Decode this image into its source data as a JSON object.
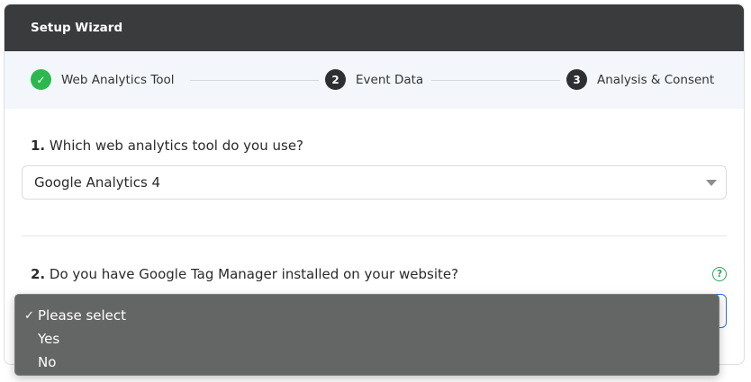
{
  "wizard": {
    "title": "Setup Wizard",
    "steps": [
      {
        "label": "Web Analytics Tool",
        "state": "complete",
        "marker": "✓"
      },
      {
        "label": "Event Data",
        "state": "pending",
        "marker": "2"
      },
      {
        "label": "Analysis & Consent",
        "state": "pending",
        "marker": "3"
      }
    ]
  },
  "question1": {
    "number": "1.",
    "text": " Which web analytics tool do you use?",
    "selected": "Google Analytics 4"
  },
  "question2": {
    "number": "2.",
    "text": " Do you have Google Tag Manager installed on your website?",
    "help_icon": "?",
    "options": [
      {
        "label": "Please select",
        "checked": true,
        "mark": "✓"
      },
      {
        "label": "Yes",
        "checked": false,
        "mark": ""
      },
      {
        "label": "No",
        "checked": false,
        "mark": ""
      }
    ]
  },
  "colors": {
    "header_bg": "#3a3b3d",
    "step_complete": "#2cb84f",
    "step_pending": "#2d2f33",
    "help_icon": "#2aa65a",
    "focus_border": "#2f6fd6",
    "dropdown_bg": "#646665"
  },
  "icons": {
    "step_complete": "check-circle-icon",
    "select_caret": "caret-down-icon",
    "help": "question-circle-icon"
  }
}
